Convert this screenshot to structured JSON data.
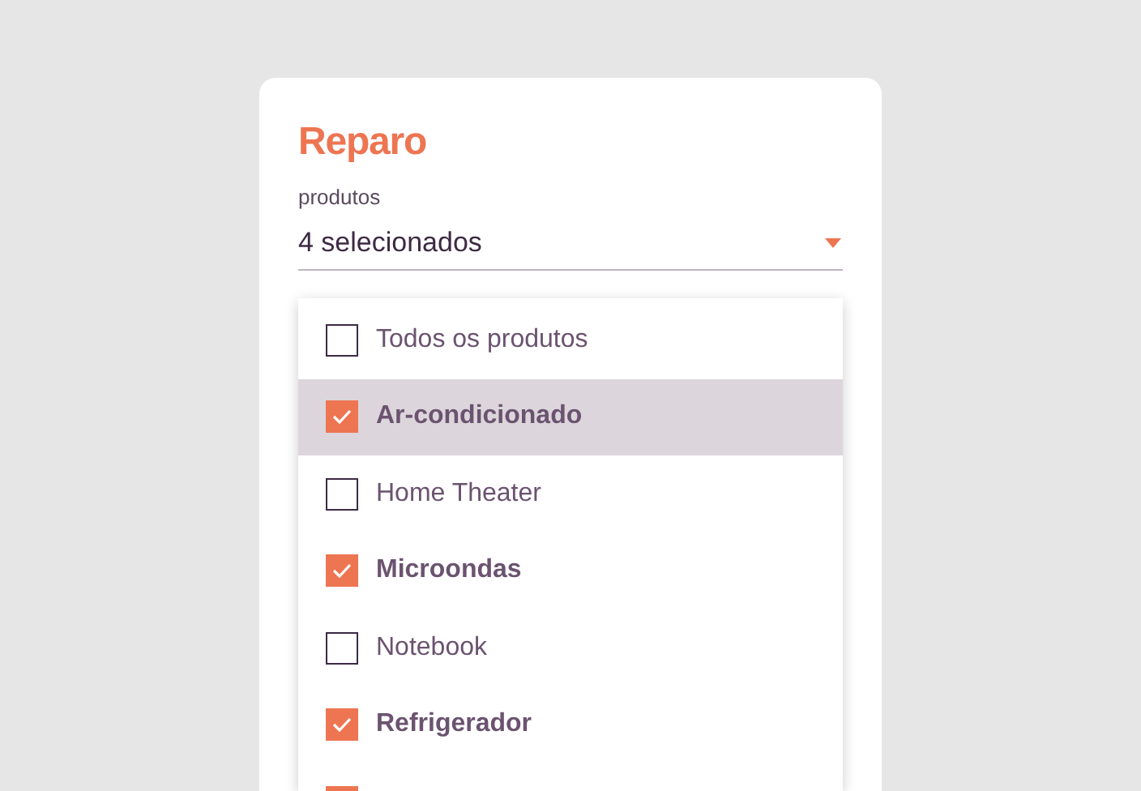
{
  "card": {
    "title": "Reparo",
    "field": {
      "label": "produtos",
      "value": "4 selecionados",
      "expanded": true
    },
    "options": [
      {
        "label": "Todos os produtos",
        "checked": false,
        "selected": false
      },
      {
        "label": "Ar-condicionado",
        "checked": true,
        "selected": true
      },
      {
        "label": "Home Theater",
        "checked": false,
        "selected": false
      },
      {
        "label": "Microondas",
        "checked": true,
        "selected": false
      },
      {
        "label": "Notebook",
        "checked": false,
        "selected": false
      },
      {
        "label": "Refrigerador",
        "checked": true,
        "selected": false
      },
      {
        "checked": true,
        "selected": false
      }
    ]
  }
}
